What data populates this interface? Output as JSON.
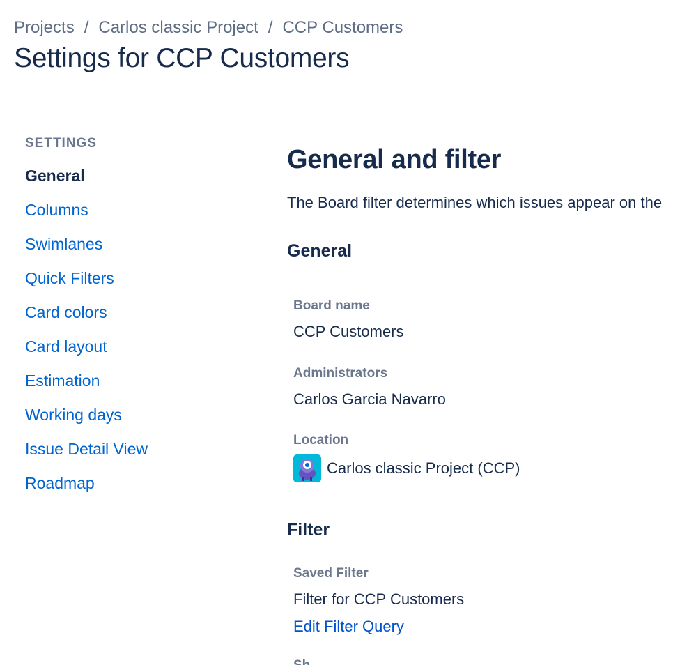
{
  "breadcrumbs": [
    {
      "label": "Projects"
    },
    {
      "label": "Carlos classic Project"
    },
    {
      "label": "CCP Customers"
    }
  ],
  "breadcrumb_separator": "/",
  "page_title": "Settings for CCP Customers",
  "sidebar": {
    "heading": "SETTINGS",
    "items": [
      {
        "label": "General",
        "active": true
      },
      {
        "label": "Columns"
      },
      {
        "label": "Swimlanes"
      },
      {
        "label": "Quick Filters"
      },
      {
        "label": "Card colors"
      },
      {
        "label": "Card layout"
      },
      {
        "label": "Estimation"
      },
      {
        "label": "Working days"
      },
      {
        "label": "Issue Detail View"
      },
      {
        "label": "Roadmap"
      }
    ]
  },
  "main": {
    "title": "General and filter",
    "description": "The Board filter determines which issues appear on the",
    "general_section": {
      "title": "General",
      "board_name_label": "Board name",
      "board_name_value": "CCP Customers",
      "administrators_label": "Administrators",
      "administrators_value": "Carlos Garcia Navarro",
      "location_label": "Location",
      "location_value": "Carlos classic Project (CCP)",
      "location_icon": "project-avatar-icon"
    },
    "filter_section": {
      "title": "Filter",
      "saved_filter_label": "Saved Filter",
      "saved_filter_value": "Filter for CCP Customers",
      "edit_link": "Edit Filter Query",
      "next_label_partial": "Sh"
    }
  },
  "colors": {
    "primary_text": "#172b4d",
    "secondary_text": "#5e6c84",
    "link": "#0065d0",
    "avatar_bg": "#00b8d9"
  }
}
